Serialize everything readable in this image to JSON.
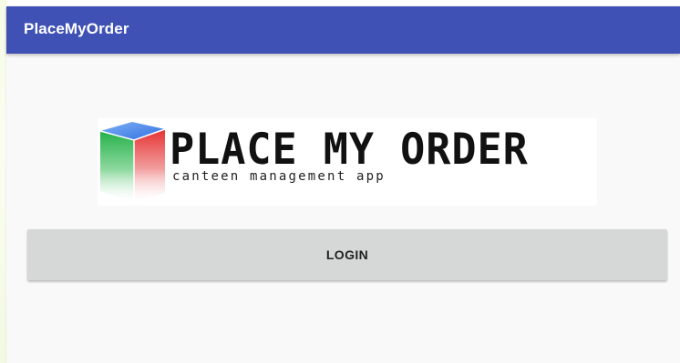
{
  "app_bar": {
    "title": "PlaceMyOrder",
    "color": "#3f51b5"
  },
  "logo": {
    "title": "PLACE MY ORDER",
    "subtitle": "canteen management app",
    "cube_colors": [
      "#2f6fe0",
      "#e03b3b",
      "#2aa84a"
    ]
  },
  "login_button": {
    "label": "LOGIN",
    "color": "#d6d7d7"
  }
}
